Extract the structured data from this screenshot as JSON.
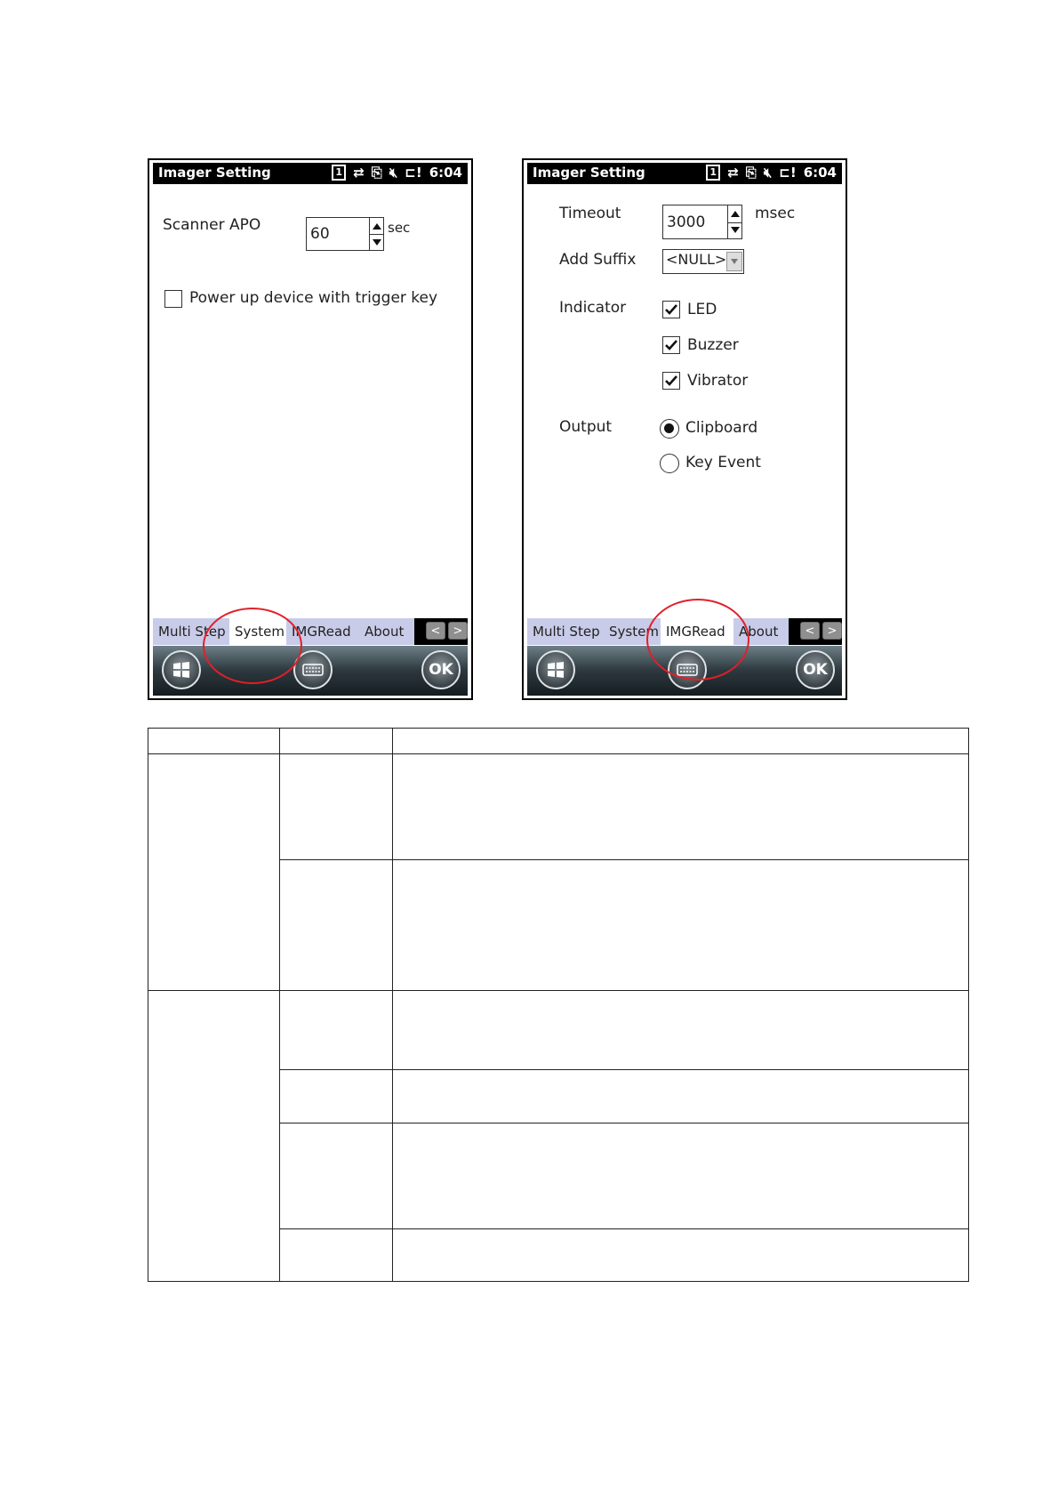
{
  "left_screen": {
    "title": "Imager Setting",
    "status": {
      "signal": "1",
      "clock": "6:04"
    },
    "scanner_apo": {
      "label": "Scanner APO",
      "value": "60",
      "unit": "sec"
    },
    "power_up": {
      "label": "Power up device with trigger key",
      "checked": false
    },
    "tabs": [
      "Multi Step",
      "System",
      "IMGRead",
      "About"
    ],
    "active_tab": "System",
    "ok_label": "OK"
  },
  "right_screen": {
    "title": "Imager Setting",
    "status": {
      "signal": "1",
      "clock": "6:04"
    },
    "timeout": {
      "label": "Timeout",
      "value": "3000",
      "unit": "msec"
    },
    "add_suffix": {
      "label": "Add Suffix",
      "value": "<NULL>"
    },
    "indicator": {
      "label": "Indicator",
      "led": "LED",
      "buzzer": "Buzzer",
      "vibrator": "Vibrator",
      "led_checked": true,
      "buzzer_checked": true,
      "vibrator_checked": true
    },
    "output": {
      "label": "Output",
      "clipboard": "Clipboard",
      "key_event": "Key Event",
      "selected": "Clipboard"
    },
    "tabs": [
      "Multi Step",
      "System",
      "IMGRead",
      "About"
    ],
    "active_tab": "IMGRead",
    "ok_label": "OK"
  },
  "colors": {
    "annotation": "#e0202a",
    "tab_inactive": "#c9cce8",
    "title_bar": "#000000"
  }
}
